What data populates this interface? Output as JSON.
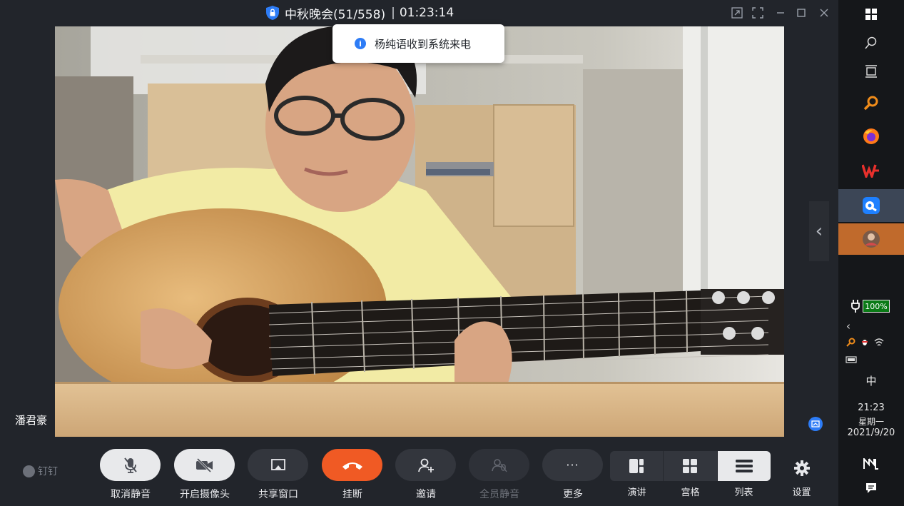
{
  "window": {
    "meeting_name": "中秋晚会(51/558)",
    "separator": "|",
    "timer": "01:23:14"
  },
  "toast": {
    "message": "杨纯语收到系统来电"
  },
  "video": {
    "speaker_name": "潘君豪"
  },
  "toolbar": {
    "brand_label": "钉钉",
    "buttons": [
      {
        "label": "取消静音",
        "icon": "microphone-muted-icon"
      },
      {
        "label": "开启摄像头",
        "icon": "camera-off-icon"
      },
      {
        "label": "共享窗口",
        "icon": "share-window-icon"
      },
      {
        "label": "挂断",
        "icon": "hang-up-icon"
      },
      {
        "label": "邀请",
        "icon": "add-user-icon"
      },
      {
        "label": "全员静音",
        "icon": "mute-all-icon"
      },
      {
        "label": "更多",
        "icon": "more-icon"
      }
    ],
    "layouts": [
      {
        "label": "演讲",
        "icon": "speaker-layout-icon"
      },
      {
        "label": "宫格",
        "icon": "grid-layout-icon"
      },
      {
        "label": "列表",
        "icon": "list-layout-icon"
      }
    ],
    "settings_label": "设置"
  },
  "taskbar": {
    "battery": "100%",
    "ime": "中",
    "time": "21:23",
    "weekday": "星期一",
    "date": "2021/9/20"
  },
  "colors": {
    "accent_blue": "#2d7cf6",
    "hangup_red": "#f05a24",
    "battery_green": "#0a7a16"
  }
}
